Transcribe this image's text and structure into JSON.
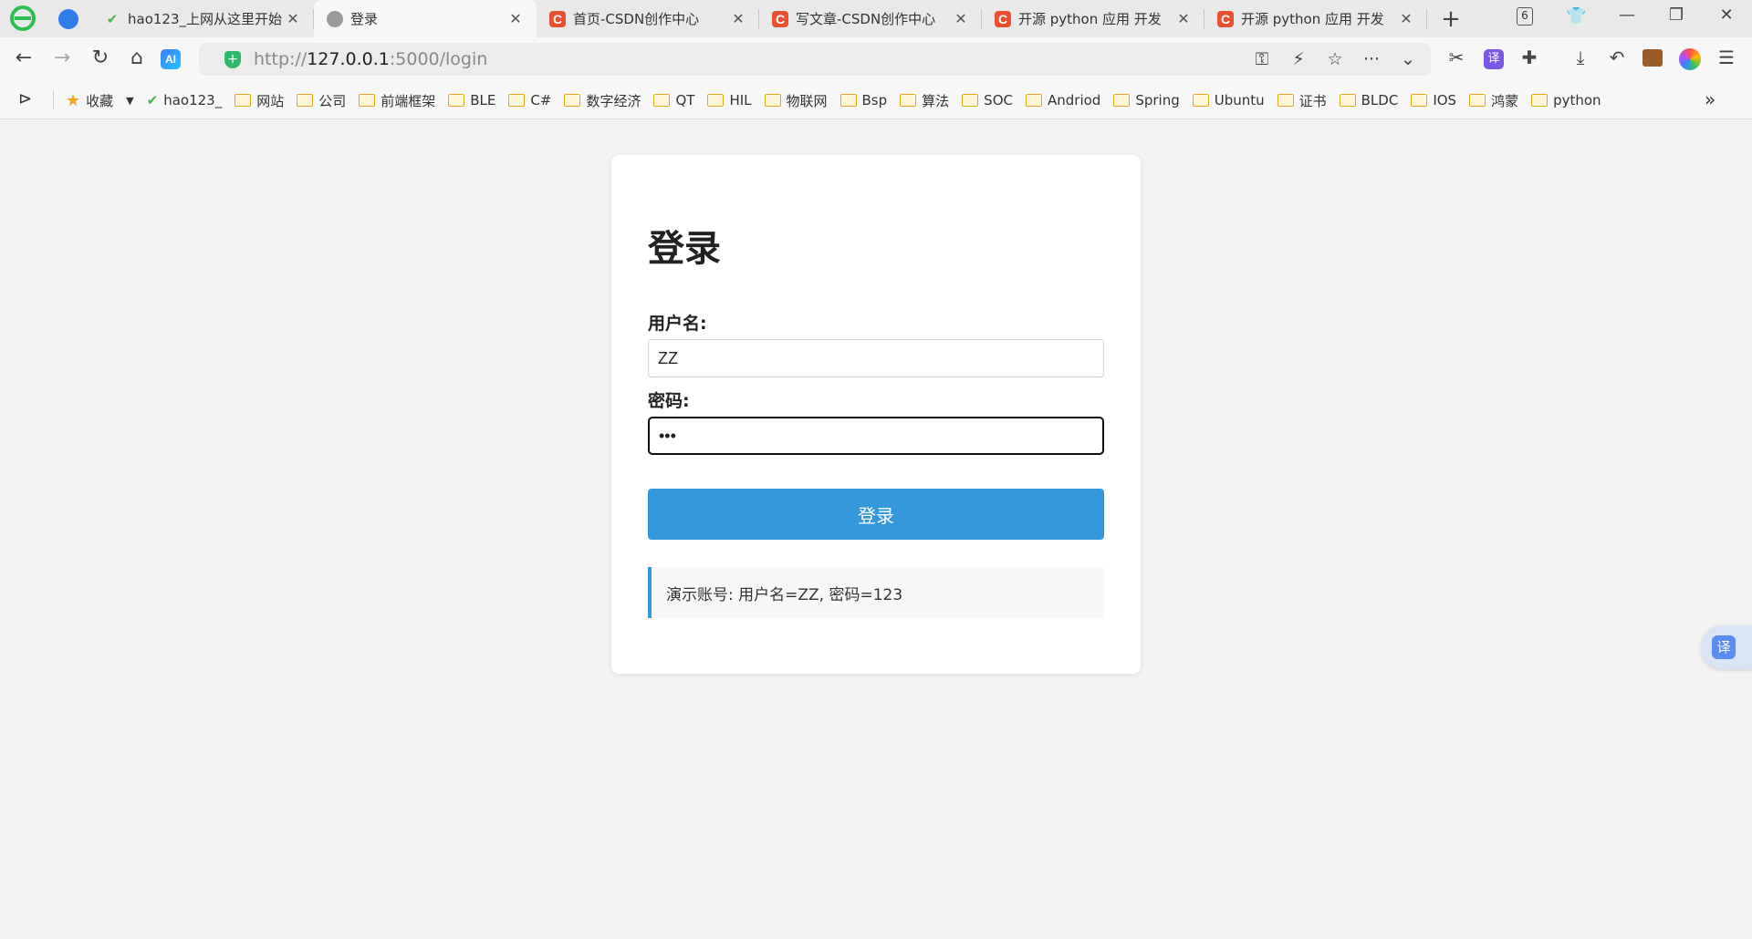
{
  "tabs": [
    {
      "title": "hao123_上网从这里开始",
      "favicon": "hao123-icon",
      "active": false
    },
    {
      "title": "登录",
      "favicon": "globe-icon",
      "active": true
    },
    {
      "title": "首页-CSDN创作中心",
      "favicon": "csdn-icon",
      "active": false
    },
    {
      "title": "写文章-CSDN创作中心",
      "favicon": "csdn-icon",
      "active": false
    },
    {
      "title": "开源 python 应用 开发",
      "favicon": "csdn-icon",
      "active": false
    },
    {
      "title": "开源 python 应用 开发",
      "favicon": "csdn-icon",
      "active": false
    }
  ],
  "tab_count": "6",
  "address": {
    "scheme": "http://",
    "host": "127.0.0.1",
    "rest": ":5000/login"
  },
  "bookmarks": {
    "favorites_label": "收藏",
    "items": [
      "hao123_",
      "网站",
      "公司",
      "前端框架",
      "BLE",
      "C#",
      "数字经济",
      "QT",
      "HIL",
      "物联网",
      "Bsp",
      "算法",
      "SOC",
      "Andriod",
      "Spring",
      "Ubuntu",
      "证书",
      "BLDC",
      "IOS",
      "鸿蒙",
      "python"
    ]
  },
  "login": {
    "title": "登录",
    "username_label": "用户名:",
    "username_value": "ZZ",
    "password_label": "密码:",
    "password_value": "123",
    "submit_label": "登录",
    "hint": "演示账号: 用户名=ZZ, 密码=123"
  },
  "floating_translate_label": "译",
  "toolbar_translate_label": "译",
  "ai_label": "AI",
  "colors": {
    "accent": "#3498db",
    "background": "#f2f2f2",
    "card": "#ffffff"
  }
}
